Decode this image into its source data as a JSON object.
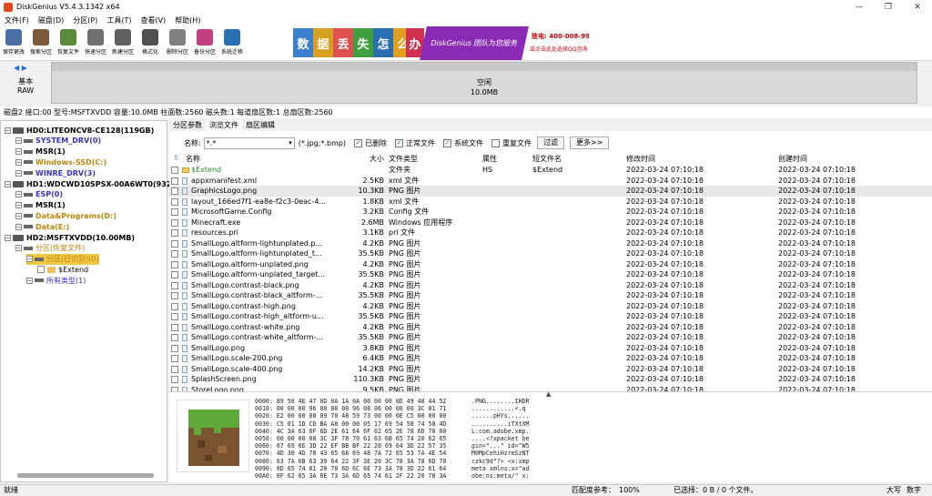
{
  "window": {
    "title": "DiskGenius V5.4.3.1342 x64",
    "brand_color": "#e34a1f"
  },
  "menu": [
    "文件(F)",
    "磁盘(D)",
    "分区(P)",
    "工具(T)",
    "查看(V)",
    "帮助(H)"
  ],
  "toolbar": [
    {
      "label": "保存更改",
      "icon": "save-icon",
      "color": "#4a6fa5"
    },
    {
      "label": "搜索分区",
      "icon": "search-icon",
      "color": "#7a5a3a"
    },
    {
      "label": "恢复文件",
      "icon": "restore-icon",
      "color": "#5a8a3a"
    },
    {
      "label": "快速分区",
      "icon": "quick-partition-icon",
      "color": "#707070"
    },
    {
      "label": "新建分区",
      "icon": "new-partition-icon",
      "color": "#606060"
    },
    {
      "label": "格式化",
      "icon": "format-icon",
      "color": "#505050"
    },
    {
      "label": "删除分区",
      "icon": "delete-icon",
      "color": "#808080"
    },
    {
      "label": "备份分区",
      "icon": "backup-icon",
      "color": "#c04080"
    },
    {
      "label": "系统迁移",
      "icon": "migrate-icon",
      "color": "#2a6fb0"
    }
  ],
  "banner": {
    "chars": [
      "数",
      "据",
      "丢",
      "失",
      "怎",
      "么",
      "办"
    ],
    "slogan": "DiskGenius 团队为您服务",
    "phone": "致电: 400-008-9958",
    "qq": "或点击此处选择QQ咨询"
  },
  "disk_strip": {
    "line1": "基本",
    "line2": "RAW",
    "bar_title": "空闲",
    "bar_size": "10.0MB"
  },
  "disk_info": "磁盘2 接口:00  型号:MSFTXVDD  容量:10.0MB  柱面数:2560  磁头数:1  每道扇区数:1  总扇区数:2560",
  "tree": [
    {
      "label": "HD0:LITEONCV8-CE128(119GB)",
      "level": 0,
      "kind": "disk",
      "color": "#000000",
      "bold": true
    },
    {
      "label": "SYSTEM_DRV(0)",
      "level": 1,
      "kind": "part",
      "color": "#3333cc",
      "bold": true
    },
    {
      "label": "MSR(1)",
      "level": 1,
      "kind": "part",
      "color": "#000000",
      "bold": true
    },
    {
      "label": "Windows-SSD(C:)",
      "level": 1,
      "kind": "part",
      "color": "#b8860b",
      "bold": true
    },
    {
      "label": "WINRE_DRV(3)",
      "level": 1,
      "kind": "part",
      "color": "#3333cc",
      "bold": true
    },
    {
      "label": "HD1:WDCWD10SPSX-00A6WT0(932G",
      "level": 0,
      "kind": "disk",
      "color": "#000000",
      "bold": true
    },
    {
      "label": "ESP(0)",
      "level": 1,
      "kind": "part",
      "color": "#3333cc",
      "bold": true
    },
    {
      "label": "MSR(1)",
      "level": 1,
      "kind": "part",
      "color": "#000000",
      "bold": true
    },
    {
      "label": "Data&Programs(D:)",
      "level": 1,
      "kind": "part",
      "color": "#b8860b",
      "bold": true
    },
    {
      "label": "Data(E:)",
      "level": 1,
      "kind": "part",
      "color": "#b8860b",
      "bold": true
    },
    {
      "label": "HD2:MSFTXVDD(10.00MB)",
      "level": 0,
      "kind": "disk",
      "color": "#000000",
      "bold": true
    },
    {
      "label": "分区(恢复文件)",
      "level": 1,
      "kind": "part",
      "color": "#b8860b",
      "bold": false
    },
    {
      "label": "分区(已识别)(0)",
      "level": 2,
      "kind": "part",
      "color": "#b8860b",
      "bold": false,
      "selected": true
    },
    {
      "label": "$Extend",
      "level": 3,
      "kind": "folder",
      "color": "#000000",
      "bold": false
    },
    {
      "label": "所有类型(1)",
      "level": 2,
      "kind": "part",
      "color": "#3333cc",
      "bold": false
    }
  ],
  "tabs": [
    "分区参数",
    "浏览文件",
    "扇区编辑"
  ],
  "active_tab": 1,
  "filter": {
    "name_label": "名称:",
    "name_value": "*.*",
    "ext_hint": "(*.jpg;*.bmp)",
    "checks": [
      {
        "label": "已删除",
        "checked": true
      },
      {
        "label": "正常文件",
        "checked": true
      },
      {
        "label": "系统文件",
        "checked": true
      },
      {
        "label": "重复文件",
        "checked": false
      }
    ],
    "filter_btn": "过滤",
    "more_btn": "更多>>"
  },
  "columns": {
    "name": "名称",
    "size": "大小",
    "type": "文件类型",
    "attr": "属性",
    "short": "短文件名",
    "modified": "修改时间",
    "created": "创建时间"
  },
  "files": [
    {
      "name": "$Extend",
      "size": "",
      "type": "文件夹",
      "attr": "HS",
      "short": "$Extend",
      "modified": "2022-03-24 07:10:18",
      "created": "2022-03-24 07:10:18",
      "folder": true
    },
    {
      "name": "appxmanifest.xml",
      "size": "2.5KB",
      "type": "xml 文件",
      "attr": "",
      "short": "",
      "modified": "2022-03-24 07:10:18",
      "created": "2022-03-24 07:10:18"
    },
    {
      "name": "GraphicsLogo.png",
      "size": "10.3KB",
      "type": "PNG 图片",
      "attr": "",
      "short": "",
      "modified": "2022-03-24 07:10:18",
      "created": "2022-03-24 07:10:18",
      "selected": true
    },
    {
      "name": "layout_166ed7f1-ea8e-f2c3-0eac-4...",
      "size": "1.8KB",
      "type": "xml 文件",
      "attr": "",
      "short": "",
      "modified": "2022-03-24 07:10:18",
      "created": "2022-03-24 07:10:18"
    },
    {
      "name": "MicrosoftGame.Config",
      "size": "3.2KB",
      "type": "Config 文件",
      "attr": "",
      "short": "",
      "modified": "2022-03-24 07:10:18",
      "created": "2022-03-24 07:10:18"
    },
    {
      "name": "Minecraft.exe",
      "size": "2.6MB",
      "type": "Windows 应用程序",
      "attr": "",
      "short": "",
      "modified": "2022-03-24 07:10:18",
      "created": "2022-03-24 07:10:18"
    },
    {
      "name": "resources.pri",
      "size": "3.1KB",
      "type": "pri 文件",
      "attr": "",
      "short": "",
      "modified": "2022-03-24 07:10:18",
      "created": "2022-03-24 07:10:18"
    },
    {
      "name": "SmallLogo.altform-lightunplated.p...",
      "size": "4.2KB",
      "type": "PNG 图片",
      "attr": "",
      "short": "",
      "modified": "2022-03-24 07:10:18",
      "created": "2022-03-24 07:10:18"
    },
    {
      "name": "SmallLogo.altform-lightunplated_t...",
      "size": "35.5KB",
      "type": "PNG 图片",
      "attr": "",
      "short": "",
      "modified": "2022-03-24 07:10:18",
      "created": "2022-03-24 07:10:18"
    },
    {
      "name": "SmallLogo.altform-unplated.png",
      "size": "4.2KB",
      "type": "PNG 图片",
      "attr": "",
      "short": "",
      "modified": "2022-03-24 07:10:18",
      "created": "2022-03-24 07:10:18"
    },
    {
      "name": "SmallLogo.altform-unplated_target...",
      "size": "35.5KB",
      "type": "PNG 图片",
      "attr": "",
      "short": "",
      "modified": "2022-03-24 07:10:18",
      "created": "2022-03-24 07:10:18"
    },
    {
      "name": "SmallLogo.contrast-black.png",
      "size": "4.2KB",
      "type": "PNG 图片",
      "attr": "",
      "short": "",
      "modified": "2022-03-24 07:10:18",
      "created": "2022-03-24 07:10:18"
    },
    {
      "name": "SmallLogo.contrast-black_altform-...",
      "size": "35.5KB",
      "type": "PNG 图片",
      "attr": "",
      "short": "",
      "modified": "2022-03-24 07:10:18",
      "created": "2022-03-24 07:10:18"
    },
    {
      "name": "SmallLogo.contrast-high.png",
      "size": "4.2KB",
      "type": "PNG 图片",
      "attr": "",
      "short": "",
      "modified": "2022-03-24 07:10:18",
      "created": "2022-03-24 07:10:18"
    },
    {
      "name": "SmallLogo.contrast-high_altform-u...",
      "size": "35.5KB",
      "type": "PNG 图片",
      "attr": "",
      "short": "",
      "modified": "2022-03-24 07:10:18",
      "created": "2022-03-24 07:10:18"
    },
    {
      "name": "SmallLogo.contrast-white.png",
      "size": "4.2KB",
      "type": "PNG 图片",
      "attr": "",
      "short": "",
      "modified": "2022-03-24 07:10:18",
      "created": "2022-03-24 07:10:18"
    },
    {
      "name": "SmallLogo.contrast-white_altform-...",
      "size": "35.5KB",
      "type": "PNG 图片",
      "attr": "",
      "short": "",
      "modified": "2022-03-24 07:10:18",
      "created": "2022-03-24 07:10:18"
    },
    {
      "name": "SmallLogo.png",
      "size": "3.8KB",
      "type": "PNG 图片",
      "attr": "",
      "short": "",
      "modified": "2022-03-24 07:10:18",
      "created": "2022-03-24 07:10:18"
    },
    {
      "name": "SmallLogo.scale-200.png",
      "size": "6.4KB",
      "type": "PNG 图片",
      "attr": "",
      "short": "",
      "modified": "2022-03-24 07:10:18",
      "created": "2022-03-24 07:10:18"
    },
    {
      "name": "SmallLogo.scale-400.png",
      "size": "14.2KB",
      "type": "PNG 图片",
      "attr": "",
      "short": "",
      "modified": "2022-03-24 07:10:18",
      "created": "2022-03-24 07:10:18"
    },
    {
      "name": "SplashScreen.png",
      "size": "110.3KB",
      "type": "PNG 图片",
      "attr": "",
      "short": "",
      "modified": "2022-03-24 07:10:18",
      "created": "2022-03-24 07:10:18"
    },
    {
      "name": "StoreLogo.png",
      "size": "9.5KB",
      "type": "PNG 图片",
      "attr": "",
      "short": "",
      "modified": "2022-03-24 07:10:18",
      "created": "2022-03-24 07:10:18"
    }
  ],
  "hex_lines": [
    "0000: 89 50 4E 47 0D 0A 1A 0A 00 00 00 0D 49 48 44 52",
    "0010: 00 00 00 96 00 00 00 96 08 06 00 00 00 3C 01 71",
    "0020: E2 00 00 00 09 70 48 59 73 00 00 0E C5 00 00 00",
    "0030: C5 01 1D CD BA A8 00 00 05 17 69 54 58 74 58 4D",
    "0040: 4C 3A 63 6F 6D 2E 61 64 6F 62 65 2E 78 6D 70 00",
    "0050: 00 00 00 00 3C 3F 78 70 61 63 6B 65 74 20 62 65",
    "0060: 67 69 6E 3D 22 EF BB BF 22 20 69 64 3D 22 57 35",
    "0070: 4D 30 4D 70 43 65 68 69 48 7A 72 65 53 7A 4E 54",
    "0080: 63 7A 6B 63 39 64 22 3F 3E 20 3C 78 3A 78 6D 70",
    "0090: 6D 65 74 61 20 78 6D 6C 6E 73 3A 78 3D 22 61 64",
    "00A0: 6F 62 65 3A 6E 73 3A 6D 65 74 61 2F 22 20 78 3A"
  ],
  "ascii_lines": [
    ".PNG........IHDR",
    "............<.q",
    "......pHYs......",
    "..........iTXtXM",
    "L:com.adobe.xmp.",
    "....<?xpacket be",
    "gin=\"...\" id=\"W5",
    "M0MpCehiHzreSzNT",
    "czkc9d\"?> <x:xmp",
    "meta xmlns:x=\"ad",
    "obe:ns:meta/\" x:"
  ],
  "status": {
    "left": "就绪",
    "ratio": "匹配度参考：",
    "ratio_val": "100%",
    "selected": "已选择：0 B / 0 个文件。",
    "caps": "大写",
    "num": "数字"
  }
}
